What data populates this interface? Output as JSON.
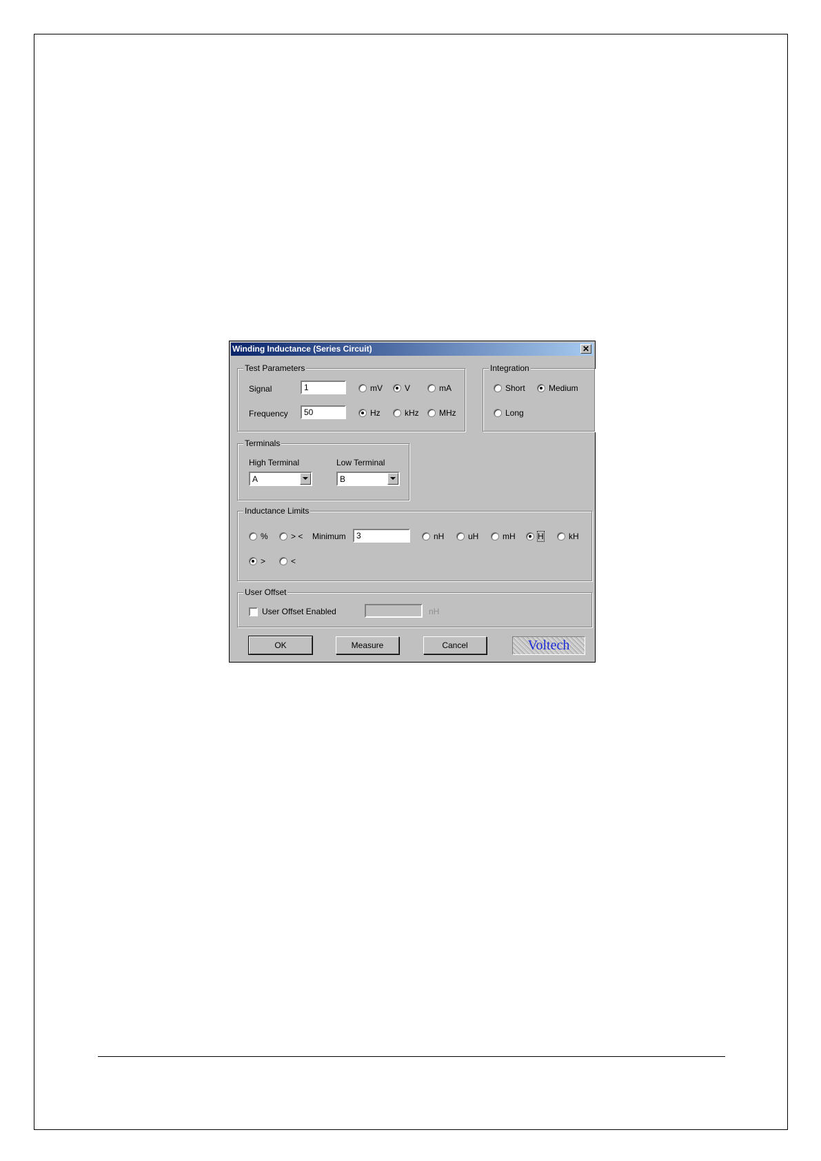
{
  "dialog": {
    "title": "Winding Inductance (Series Circuit)",
    "close_symbol": "✕"
  },
  "test_parameters": {
    "label": "Test Parameters",
    "signal_label": "Signal",
    "signal_value": "1",
    "signal_units": [
      {
        "label": "mV",
        "selected": false
      },
      {
        "label": "V",
        "selected": true
      },
      {
        "label": "mA",
        "selected": false
      }
    ],
    "frequency_label": "Frequency",
    "frequency_value": "50",
    "frequency_units": [
      {
        "label": "Hz",
        "selected": true
      },
      {
        "label": "kHz",
        "selected": false
      },
      {
        "label": "MHz",
        "selected": false
      }
    ]
  },
  "integration": {
    "label": "Integration",
    "options": [
      {
        "label": "Short",
        "selected": false
      },
      {
        "label": "Medium",
        "selected": true
      },
      {
        "label": "Long",
        "selected": false
      }
    ]
  },
  "terminals": {
    "label": "Terminals",
    "high_label": "High Terminal",
    "high_value": "A",
    "low_label": "Low Terminal",
    "low_value": "B"
  },
  "inductance_limits": {
    "label": "Inductance Limits",
    "modes": [
      {
        "label": "%",
        "selected": false
      },
      {
        "label": "> <",
        "selected": false
      },
      {
        "label": ">",
        "selected": true
      },
      {
        "label": "<",
        "selected": false
      }
    ],
    "minimum_label": "Minimum",
    "minimum_value": "3",
    "units": [
      {
        "label": "nH",
        "selected": false
      },
      {
        "label": "uH",
        "selected": false
      },
      {
        "label": "mH",
        "selected": false
      },
      {
        "label": "H",
        "selected": true
      },
      {
        "label": "kH",
        "selected": false
      }
    ]
  },
  "user_offset": {
    "label": "User Offset",
    "enabled_label": "User Offset Enabled",
    "enabled": false,
    "value": "",
    "unit": "nH"
  },
  "buttons": {
    "ok": "OK",
    "measure": "Measure",
    "cancel": "Cancel"
  },
  "logo": {
    "text": "Voltech",
    "color": "#1c2bd6"
  }
}
